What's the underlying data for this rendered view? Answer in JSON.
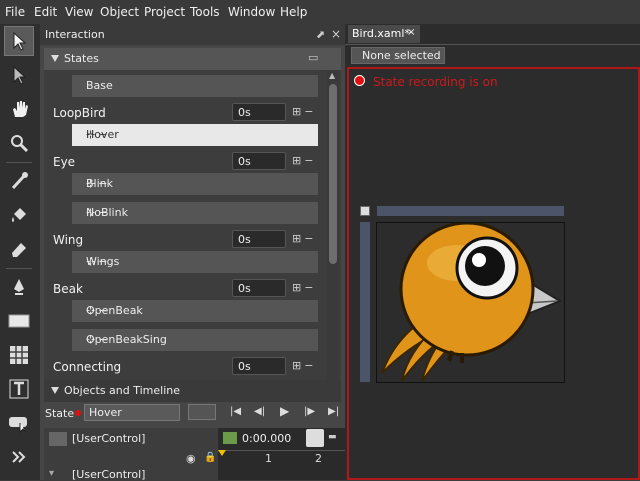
{
  "menu": [
    "File",
    "Edit",
    "View",
    "Object",
    "Project",
    "Tools",
    "Window",
    "Help"
  ],
  "interaction_panel": {
    "title": "Interaction",
    "states_section": "States",
    "base_label": "Base",
    "groups": [
      {
        "name": "LoopBird",
        "time": "0s",
        "states": [
          "Hover"
        ]
      },
      {
        "name": "Eye",
        "time": "0s",
        "states": [
          "Blink",
          "NoBlink"
        ]
      },
      {
        "name": "Wing",
        "time": "0s",
        "states": [
          "Wings"
        ]
      },
      {
        "name": "Beak",
        "time": "0s",
        "states": [
          "OpenBeak",
          "OpenBeakSing"
        ]
      },
      {
        "name": "Connecting",
        "time": "0s",
        "states": []
      }
    ],
    "selected_state": "Hover",
    "objects_section": "Objects and Timeline",
    "state_label": "State",
    "state_value": "Hover",
    "tree_root": "[UserControl]",
    "tree_child": "[UserControl]",
    "time_display": "0:00.000",
    "ruler_ticks": [
      "1",
      "2"
    ]
  },
  "document": {
    "tab_title": "Bird.xaml*",
    "tab_close": "×",
    "selection": "None selected",
    "recording_text": "State recording is on"
  },
  "colors": {
    "accent_record": "#cc1a1a",
    "bird_body": "#e0951a",
    "beak": "#c8c8c8"
  }
}
